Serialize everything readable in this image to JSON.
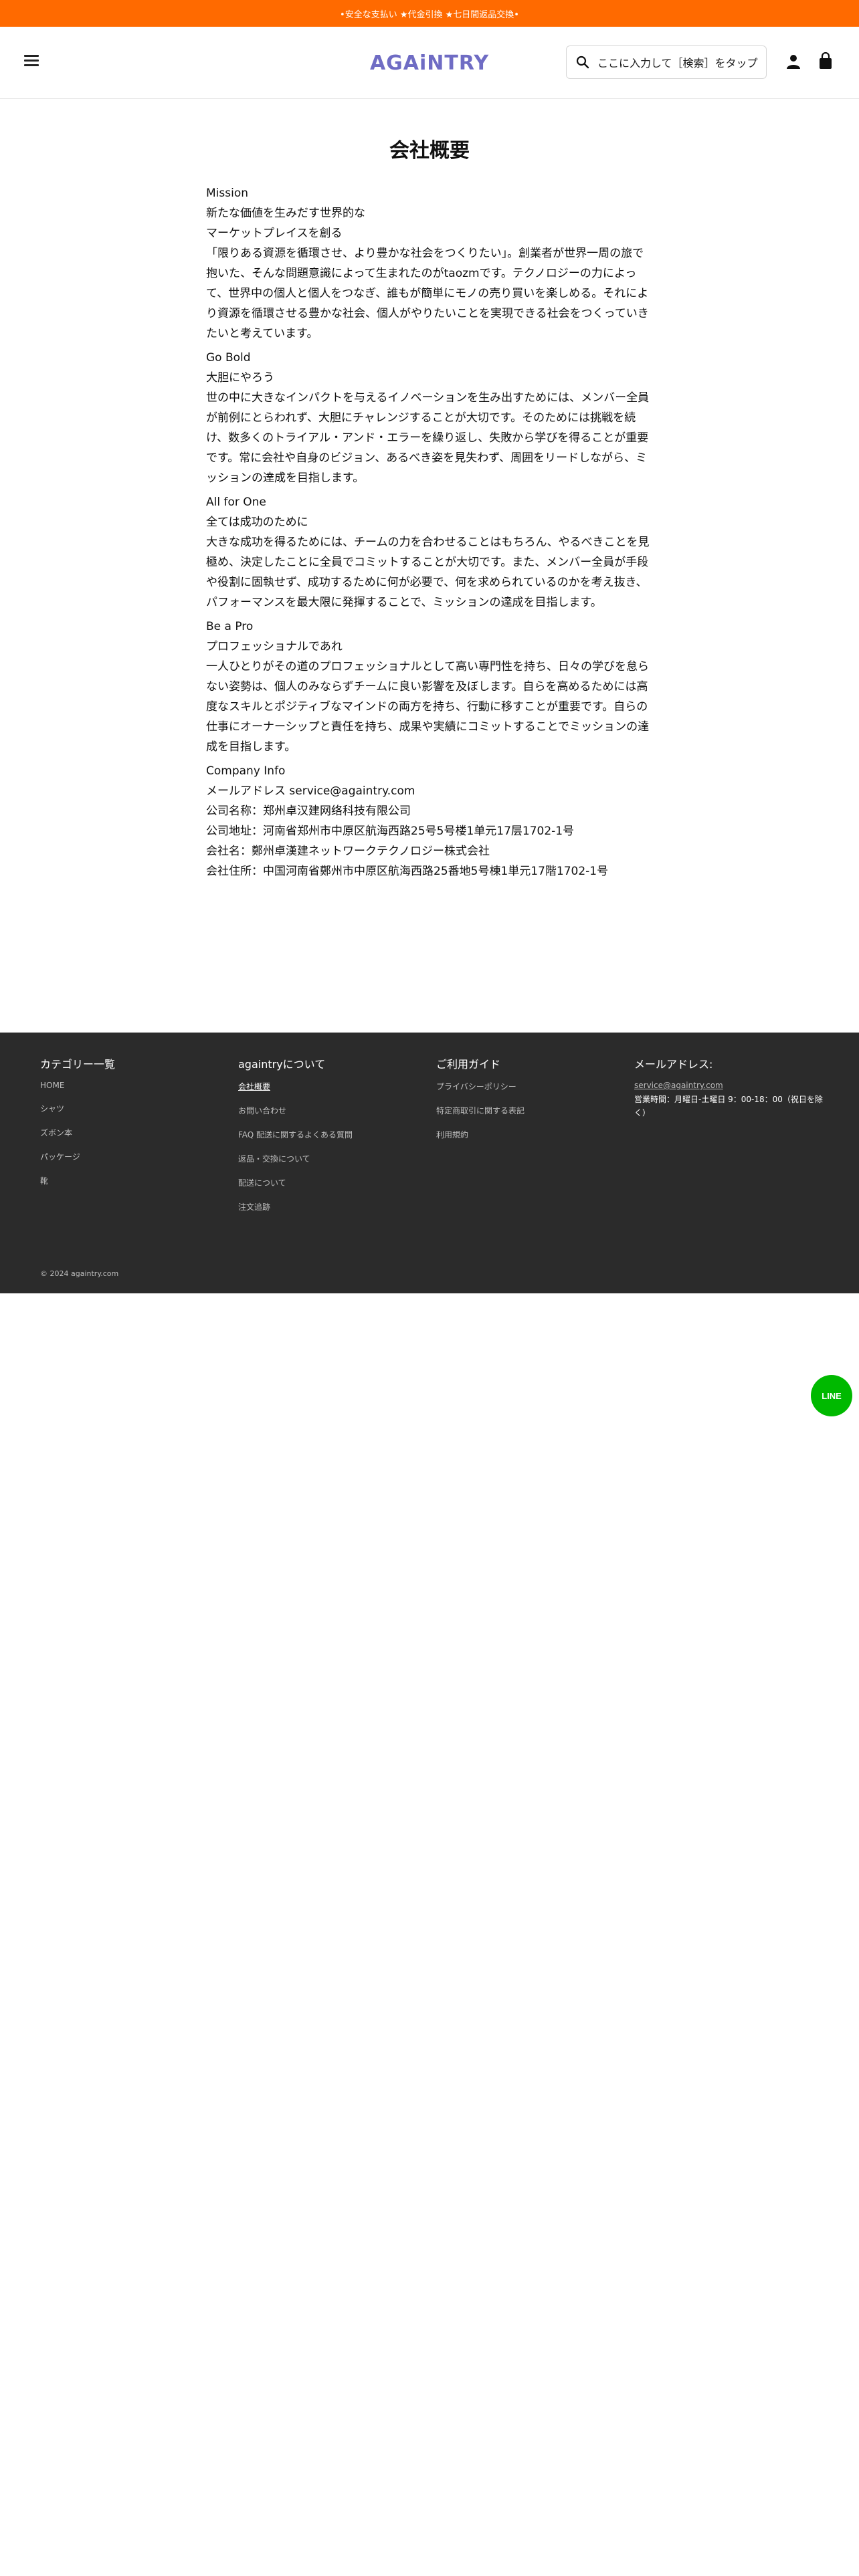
{
  "announcement": "•安全な支払い ★代金引換 ★七日間返品交換•",
  "header": {
    "logo": "AGAiNTRY",
    "search_placeholder": "ここに入力して［検索］をタップ",
    "icons": [
      "menu-icon",
      "search-icon",
      "user-icon",
      "cart-icon"
    ]
  },
  "page": {
    "title": "会社概要",
    "sections": [
      {
        "heading": "Mission",
        "subheading": "新たな価値を生みだす世界的な",
        "subheading2": "マーケットプレイスを創る",
        "body": "「限りある資源を循環させ、より豊かな社会をつくりたい」。創業者が世界一周の旅で抱いた、そんな問題意識によって生まれたのがtaozmです。テクノロジーの力によって、世界中の個人と個人をつなぎ、誰もが簡単にモノの売り買いを楽しめる。それにより資源を循環させる豊かな社会、個人がやりたいことを実現できる社会をつくっていきたいと考えています。"
      },
      {
        "heading": "Go Bold",
        "subheading": "大胆にやろう",
        "body": "世の中に大きなインパクトを与えるイノベーションを生み出すためには、メンバー全員が前例にとらわれず、大胆にチャレンジすることが大切です。そのためには挑戦を続け、数多くのトライアル・アンド・エラーを繰り返し、失敗から学びを得ることが重要です。常に会社や自身のビジョン、あるべき姿を見失わず、周囲をリードしながら、ミッションの達成を目指します。"
      },
      {
        "heading": "All for One",
        "subheading": "全ては成功のために",
        "body": "大きな成功を得るためには、チームの力を合わせることはもちろん、やるべきことを見極め、決定したことに全員でコミットすることが大切です。また、メンバー全員が手段や役割に固執せず、成功するために何が必要で、何を求められているのかを考え抜き、パフォーマンスを最大限に発揮することで、ミッションの達成を目指します。"
      },
      {
        "heading": "Be a Pro",
        "subheading": "プロフェッショナルであれ",
        "body": "一人ひとりがその道のプロフェッショナルとして高い専門性を持ち、日々の学びを怠らない姿勢は、個人のみならずチームに良い影響を及ぼします。自らを高めるためには高度なスキルとポジティブなマインドの両方を持ち、行動に移すことが重要です。自らの仕事にオーナーシップと責任を持ち、成果や実績にコミットすることでミッションの達成を目指します。"
      }
    ],
    "company_info": {
      "heading": "Company Info",
      "email_line": "メールアドレス service@againtry.com",
      "lines": [
        "公司名称：郑州卓汉建网络科技有限公司",
        "公司地址：河南省郑州市中原区航海西路25号5号楼1单元17层1702-1号",
        "会社名：鄭州卓漢建ネットワークテクノロジー株式会社",
        "会社住所：中国河南省鄭州市中原区航海西路25番地5号棟1単元17階1702-1号"
      ]
    }
  },
  "footer": {
    "col1": {
      "title": "カテゴリー一覧",
      "links": [
        "HOME",
        "シャツ",
        "ズボン本",
        "パッケージ",
        "靴"
      ]
    },
    "col2": {
      "title": "againtryについて",
      "links": [
        "会社概要",
        "お問い合わせ",
        "FAQ 配送に関するよくある質問",
        "返品・交換について",
        "配送について",
        "注文追跡"
      ]
    },
    "col3": {
      "title": "ご利用ガイド",
      "links": [
        "プライバシーポリシー",
        "特定商取引に関する表記",
        "利用規約"
      ]
    },
    "col4": {
      "title": "メールアドレス:",
      "email": "service@againtry.com",
      "hours": "営業時間：月曜日-土曜日 9：00-18：00（祝日を除く）"
    },
    "copyright": "© 2024 againtry.com"
  },
  "line_button": "LINE",
  "colors": {
    "announcement_bg": "#ff6a00",
    "logo": "#6f6cc4",
    "footer_bg": "#2b2b2b",
    "line": "#00b900"
  }
}
